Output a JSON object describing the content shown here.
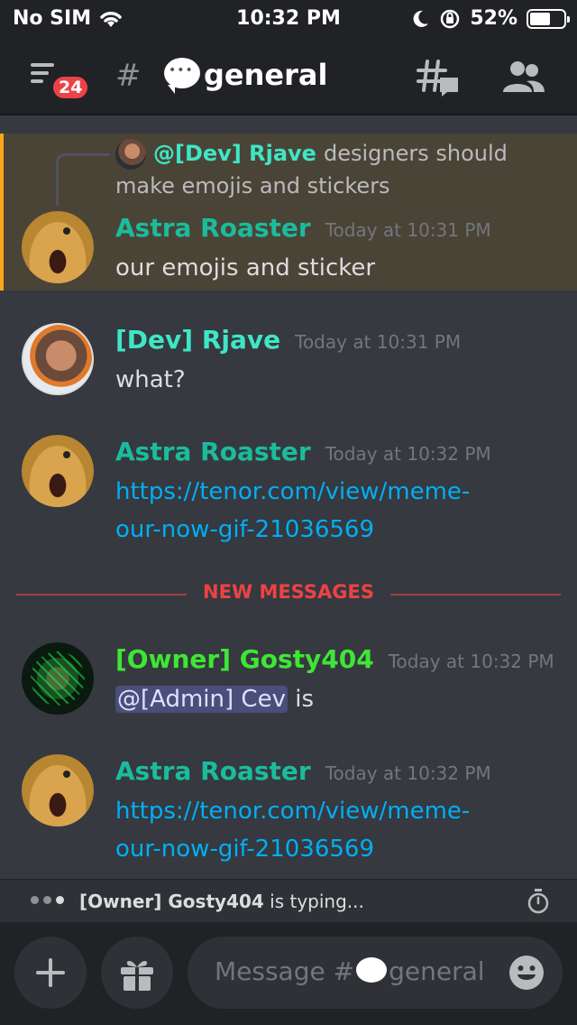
{
  "status_bar": {
    "carrier": "No SIM",
    "time": "10:32 PM",
    "battery": "52%",
    "battery_level": 0.52
  },
  "header": {
    "badge_count": "24",
    "hash": "#",
    "channel_name": "general"
  },
  "reply_preview": {
    "author": "@[Dev] Rjave",
    "text": "designers should make emojis and stickers"
  },
  "messages": [
    {
      "author": "Astra Roaster",
      "author_color": "#1abc9c",
      "timestamp": "Today at 10:31 PM",
      "text": "our emojis and sticker"
    },
    {
      "author": "[Dev] Rjave",
      "author_color": "#3ee6c6",
      "timestamp": "Today at 10:31 PM",
      "text": "what?"
    },
    {
      "author": "Astra Roaster",
      "author_color": "#1abc9c",
      "timestamp": "Today at 10:32 PM",
      "link": "https://tenor.com/view/meme-our-now-gif-21036569"
    },
    {
      "author": "[Owner] Gosty404",
      "author_color": "#3ee635",
      "timestamp": "Today at 10:32 PM",
      "mention": "@[Admin] Cev",
      "text": "is"
    },
    {
      "author": "Astra Roaster",
      "author_color": "#1abc9c",
      "timestamp": "Today at 10:32 PM",
      "link": "https://tenor.com/view/meme-our-now-gif-21036569"
    }
  ],
  "new_messages_label": "NEW MESSAGES",
  "typing": {
    "user": "[Owner] Gosty404",
    "suffix": "is typing..."
  },
  "composer": {
    "placeholder_prefix": "Message #",
    "placeholder_channel": "general"
  },
  "colors": {
    "background": "#36393f",
    "header": "#202225",
    "highlight": "#4a4437",
    "highlight_bar": "#faa81a",
    "link": "#00aff4",
    "new_divider": "#ed4245"
  }
}
